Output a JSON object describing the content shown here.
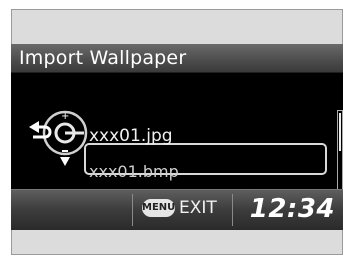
{
  "screen": {
    "title": "Import Wallpaper",
    "files": [
      {
        "name": "xxx01.jpg",
        "selected": true
      },
      {
        "name": "xxx01.bmp",
        "selected": false
      }
    ],
    "footer": {
      "menu_button": "MENU",
      "exit_label": "EXIT",
      "clock": "12:34"
    },
    "icons": {
      "back": "back-arrow-icon",
      "knob": "interface-dial-icon",
      "scroll_down": "down-triangle-icon"
    },
    "colors": {
      "background": "#000000",
      "text": "#f0f0f0",
      "bar": "#4e4e4e"
    }
  }
}
